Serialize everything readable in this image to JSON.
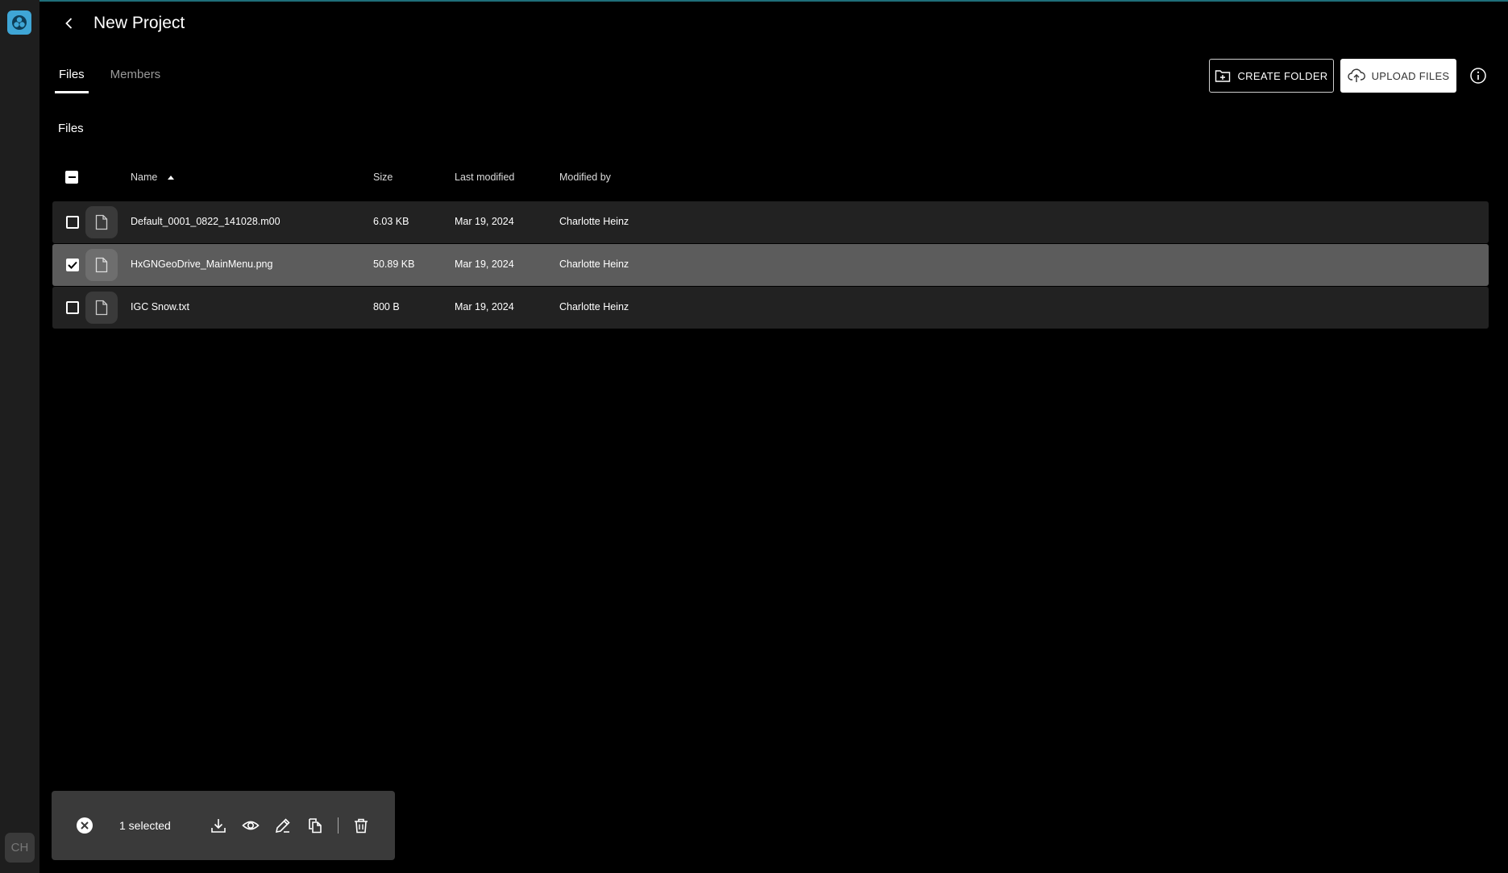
{
  "app": {
    "avatar_initials": "CH"
  },
  "header": {
    "title": "New Project"
  },
  "tabs": [
    {
      "label": "Files",
      "active": true
    },
    {
      "label": "Members",
      "active": false
    }
  ],
  "toolbar": {
    "create_folder_label": "CREATE FOLDER",
    "upload_files_label": "UPLOAD FILES"
  },
  "section": {
    "title": "Files"
  },
  "table": {
    "columns": {
      "name": "Name",
      "size": "Size",
      "last_modified": "Last modified",
      "modified_by": "Modified by"
    },
    "rows": [
      {
        "name": "Default_0001_0822_141028.m00",
        "size": "6.03 KB",
        "last_modified": "Mar 19, 2024",
        "modified_by": "Charlotte Heinz",
        "selected": false
      },
      {
        "name": "HxGNGeoDrive_MainMenu.png",
        "size": "50.89 KB",
        "last_modified": "Mar 19, 2024",
        "modified_by": "Charlotte Heinz",
        "selected": true
      },
      {
        "name": "IGC Snow.txt",
        "size": "800 B",
        "last_modified": "Mar 19, 2024",
        "modified_by": "Charlotte Heinz",
        "selected": false
      }
    ]
  },
  "selection_bar": {
    "count_label": "1 selected"
  },
  "colors": {
    "background": "#000000",
    "rail": "#1e1e1e",
    "row": "#222222",
    "row_selected": "#5c5c5c",
    "logo": "#3fa6d6"
  }
}
